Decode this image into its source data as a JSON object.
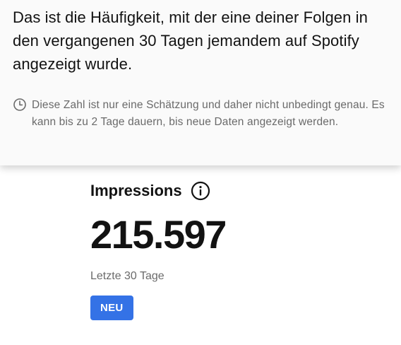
{
  "tooltip": {
    "text": "Das ist die Häufigkeit, mit der eine deiner Folgen in den vergangenen 30 Tagen jemandem auf Spotify angezeigt wurde.",
    "note_icon": "clock-icon",
    "note": "Diese Zahl ist nur eine Schätzung und daher nicht unbedingt genau. Es kann bis zu 2 Tage dauern, bis neue Daten angezeigt werden."
  },
  "card": {
    "title": "Impressions",
    "info_icon": "info-icon",
    "value": "215.597",
    "period": "Letzte 30 Tage",
    "badge": "NEU"
  },
  "colors": {
    "badge": "#3472e6",
    "text": "#121212",
    "muted": "#6a6a6a",
    "tooltip_bg": "#fafafa"
  }
}
